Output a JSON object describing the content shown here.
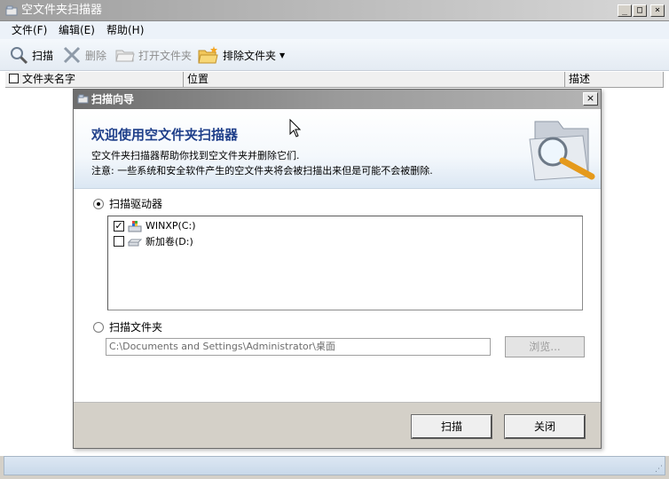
{
  "main_window": {
    "title": "空文件夹扫描器",
    "controls": {
      "minimize": "_",
      "maximize": "□",
      "close": "×"
    }
  },
  "menu": {
    "file": "文件(F)",
    "edit": "编辑(E)",
    "help": "帮助(H)"
  },
  "toolbar": {
    "scan": "扫描",
    "delete": "删除",
    "open_folder": "打开文件夹",
    "exclude_folder": "排除文件夹"
  },
  "list": {
    "columns": [
      "文件夹名字",
      "位置",
      "描述"
    ]
  },
  "dialog": {
    "title": "扫描向导",
    "close_symbol": "×",
    "banner_heading": "欢迎使用空文件夹扫描器",
    "banner_line1": "空文件夹扫描器帮助你找到空文件夹并删除它们.",
    "banner_line2": "注意: 一些系统和安全软件产生的空文件夹将会被扫描出来但是可能不会被删除.",
    "option_drives": "扫描驱动器",
    "option_folder": "扫描文件夹",
    "drives": [
      {
        "label": "WINXP(C:)",
        "checked": true,
        "icon": "system-drive-icon"
      },
      {
        "label": "新加卷(D:)",
        "checked": false,
        "icon": "disk-drive-icon"
      }
    ],
    "folder_path": "C:\\Documents and Settings\\Administrator\\桌面",
    "browse": "浏览...",
    "scan_button": "扫描",
    "close_button": "关闭"
  },
  "colors": {
    "banner_heading": "#1f3f8a",
    "menubar_bg": "#ecf2f9",
    "dialog_footer_bg": "#d4d0c8"
  }
}
